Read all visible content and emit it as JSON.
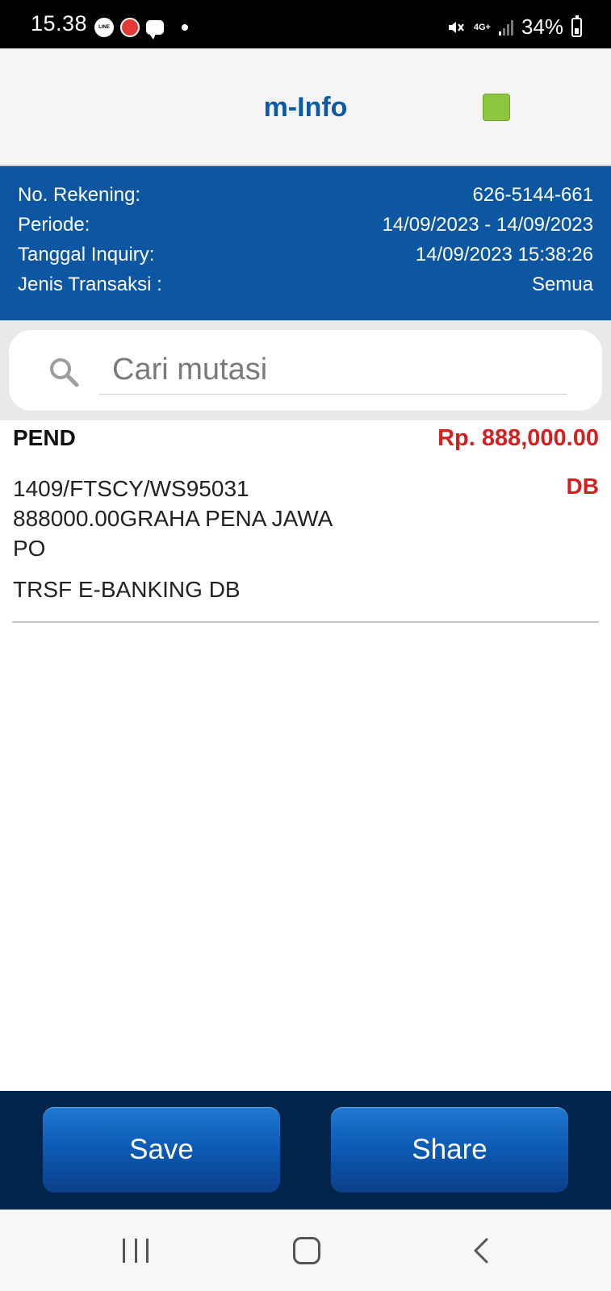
{
  "status_bar": {
    "time": "15.38",
    "notification_icons": [
      "line-icon",
      "red-app-icon",
      "message-icon",
      "dot-icon"
    ],
    "network": "4G+",
    "battery": "34%",
    "battery_level": 0.34
  },
  "header": {
    "title": "m-Info",
    "status_indicator_color": "#8dc63f"
  },
  "account_info": {
    "rows": [
      {
        "label": "No. Rekening:",
        "value": "626-5144-661"
      },
      {
        "label": "Periode:",
        "value": "14/09/2023 - 14/09/2023"
      },
      {
        "label": "Tanggal Inquiry:",
        "value": "14/09/2023 15:38:26"
      },
      {
        "label": "Jenis Transaksi :",
        "value": "Semua"
      }
    ]
  },
  "search": {
    "placeholder": "Cari mutasi",
    "value": ""
  },
  "transactions": [
    {
      "status": "PEND",
      "amount": "Rp. 888,000.00",
      "type": "DB",
      "description_lines": [
        "1409/FTSCY/WS95031",
        "888000.00GRAHA PENA JAWA",
        "PO"
      ],
      "note": "TRSF E-BANKING DB"
    }
  ],
  "actions": {
    "save_label": "Save",
    "share_label": "Share"
  },
  "colors": {
    "primary_blue": "#0c56a2",
    "title_blue": "#0c5aa6",
    "amount_red": "#d61f1f",
    "bottom_bar": "#02234a"
  }
}
